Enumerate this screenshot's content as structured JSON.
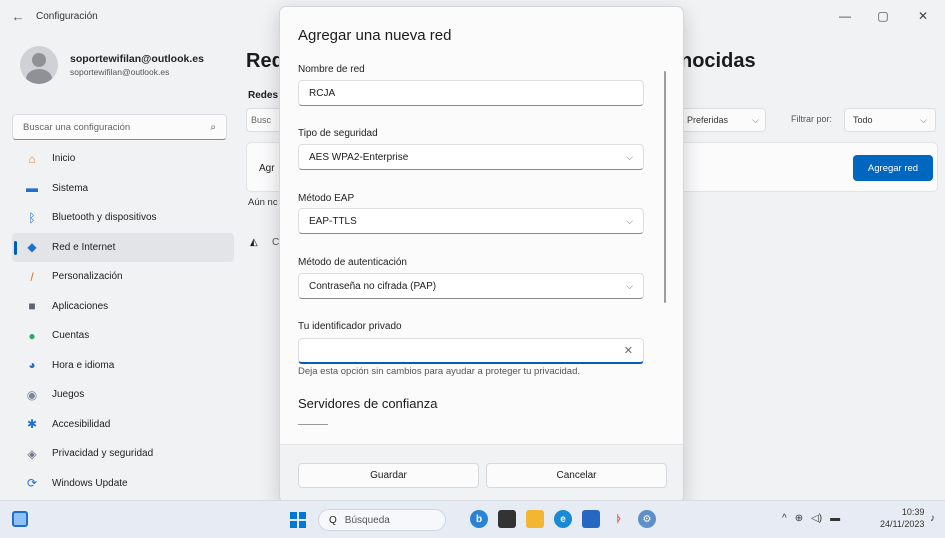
{
  "window": {
    "title": "Configuración",
    "back_glyph": "←",
    "min_glyph": "—",
    "max_glyph": "▢",
    "close_glyph": "✕"
  },
  "profile": {
    "email_bold": "soportewifilan@outlook.es",
    "email": "soportewifilan@outlook.es"
  },
  "search": {
    "placeholder": "Buscar una configuración",
    "icon_glyph": "⌕"
  },
  "sidebar": {
    "items": [
      {
        "label": "Inicio",
        "icon": "home-icon",
        "glyph": "⌂",
        "color": "#d98a2b"
      },
      {
        "label": "Sistema",
        "icon": "system-icon",
        "glyph": "▬",
        "color": "#1e6fd0"
      },
      {
        "label": "Bluetooth y dispositivos",
        "icon": "bluetooth-icon",
        "glyph": "ᛒ",
        "color": "#1e6fd0"
      },
      {
        "label": "Red e Internet",
        "icon": "network-icon",
        "glyph": "◆",
        "color": "#1e6fd0",
        "active": true
      },
      {
        "label": "Personalización",
        "icon": "brush-icon",
        "glyph": "/",
        "color": "#d2701f"
      },
      {
        "label": "Aplicaciones",
        "icon": "apps-icon",
        "glyph": "■",
        "color": "#5b6474"
      },
      {
        "label": "Cuentas",
        "icon": "accounts-icon",
        "glyph": "●",
        "color": "#2aa866"
      },
      {
        "label": "Hora e idioma",
        "icon": "globe-icon",
        "glyph": "◕",
        "color": "#1e6fd0"
      },
      {
        "label": "Juegos",
        "icon": "gamepad-icon",
        "glyph": "◉",
        "color": "#7a8699"
      },
      {
        "label": "Accesibilidad",
        "icon": "accessibility-icon",
        "glyph": "✱",
        "color": "#1e6fd0"
      },
      {
        "label": "Privacidad y seguridad",
        "icon": "shield-icon",
        "glyph": "◈",
        "color": "#6f7785"
      },
      {
        "label": "Windows Update",
        "icon": "update-icon",
        "glyph": "⟳",
        "color": "#1e6fd0"
      }
    ]
  },
  "main": {
    "heading_left": "Red",
    "heading_right": "nocidas",
    "redes_label": "Redes",
    "search_stub": "Busc",
    "order_value": "Preferidas",
    "filter_label": "Filtrar por:",
    "filter_value": "Todo",
    "card_text": "Agr",
    "add_network_button": "Agregar red",
    "aun_text": "Aún nc",
    "wifi_stub": "C"
  },
  "modal": {
    "title": "Agregar una nueva red",
    "network_name_label": "Nombre de red",
    "network_name_value": "RCJA",
    "security_type_label": "Tipo de seguridad",
    "security_type_value": "AES WPA2-Enterprise",
    "eap_method_label": "Método EAP",
    "eap_method_value": "EAP-TTLS",
    "auth_method_label": "Método de autenticación",
    "auth_method_value": "Contraseña no cifrada (PAP)",
    "private_id_label": "Tu identificador privado",
    "private_id_value": "",
    "private_id_help": "Deja esta opción sin cambios para ayudar a proteger tu privacidad.",
    "trusted_servers_label": "Servidores de confianza",
    "save_button": "Guardar",
    "cancel_button": "Cancelar"
  },
  "taskbar": {
    "search_placeholder": "Búsqueda",
    "search_glyph": "Q",
    "tray_caret": "^",
    "tray_network": "⊕",
    "tray_volume": "◁)",
    "tray_battery": "▬",
    "time": "10:39",
    "date": "24/11/2023",
    "bell_glyph": "♪"
  },
  "colors": {
    "accent": "#005fb8",
    "primary_button": "#0067c0"
  }
}
